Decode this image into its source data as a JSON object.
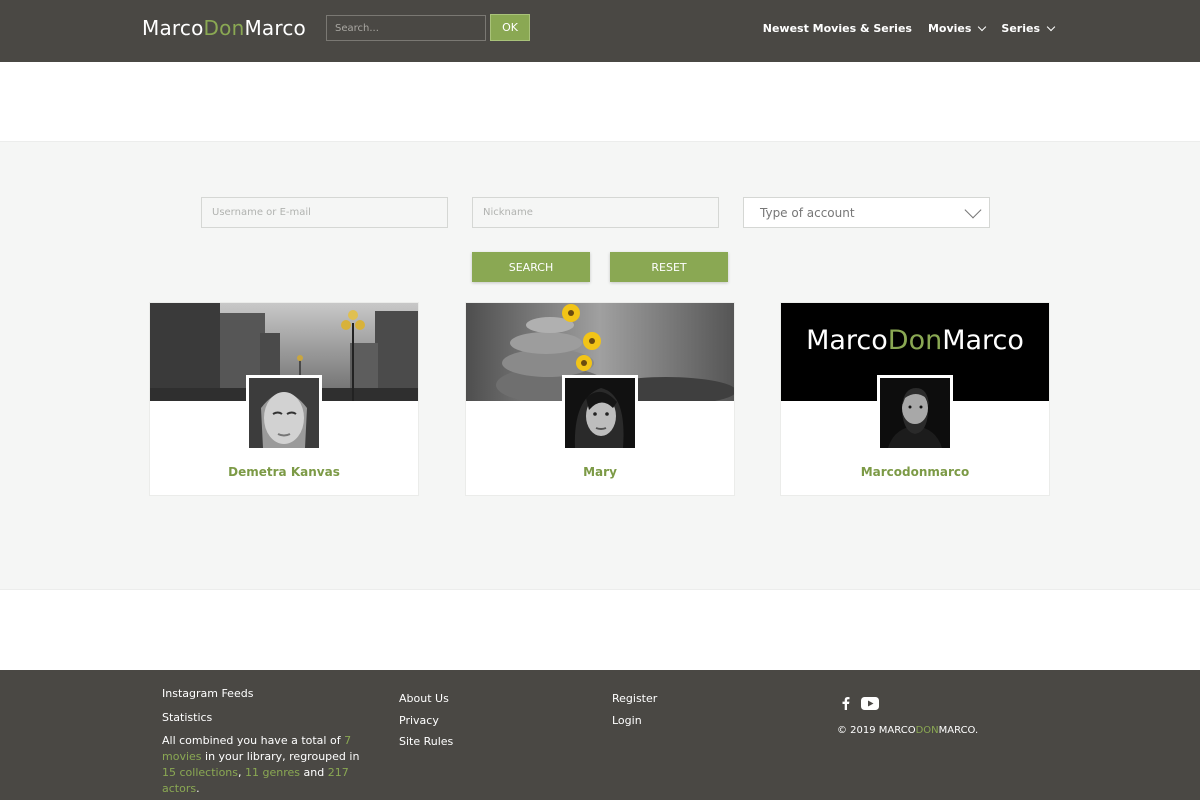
{
  "header": {
    "logo": {
      "part1": "Marco",
      "part2": "Don",
      "part3": "Marco"
    },
    "search_placeholder": "Search...",
    "ok_label": "OK",
    "nav": [
      {
        "label": "Newest Movies & Series"
      },
      {
        "label": "Movies"
      },
      {
        "label": "Series"
      }
    ]
  },
  "filters": {
    "username_placeholder": "Username or E-mail",
    "nickname_placeholder": "Nickname",
    "account_type": "Type of account",
    "search_label": "SEARCH",
    "reset_label": "RESET"
  },
  "cards": [
    {
      "name": "Demetra Kanvas"
    },
    {
      "name": "Mary"
    },
    {
      "name": "Marcodonmarco",
      "cover_logo": {
        "part1": "Marco",
        "part2": "Don",
        "part3": "Marco"
      }
    }
  ],
  "footer": {
    "col1": {
      "instagram": "Instagram Feeds",
      "statistics": "Statistics",
      "stats": {
        "t1": "All combined you have a total of ",
        "movies": "7 movies",
        "t2": " in your library, regrouped in ",
        "collections": "15 collections",
        "t3": ", ",
        "genres": "11 genres",
        "t4": " and ",
        "actors": "217 actors",
        "t5": "."
      }
    },
    "col2": [
      "About Us",
      "Privacy",
      "Site Rules"
    ],
    "col3": [
      "Register",
      "Login"
    ],
    "copyright": {
      "prefix": "© 2019 MARCO",
      "accent": "DON",
      "suffix": "MARCO."
    }
  },
  "colors": {
    "accent": "#8aa853",
    "dark": "#4a4844",
    "panel": "#f5f6f5"
  }
}
